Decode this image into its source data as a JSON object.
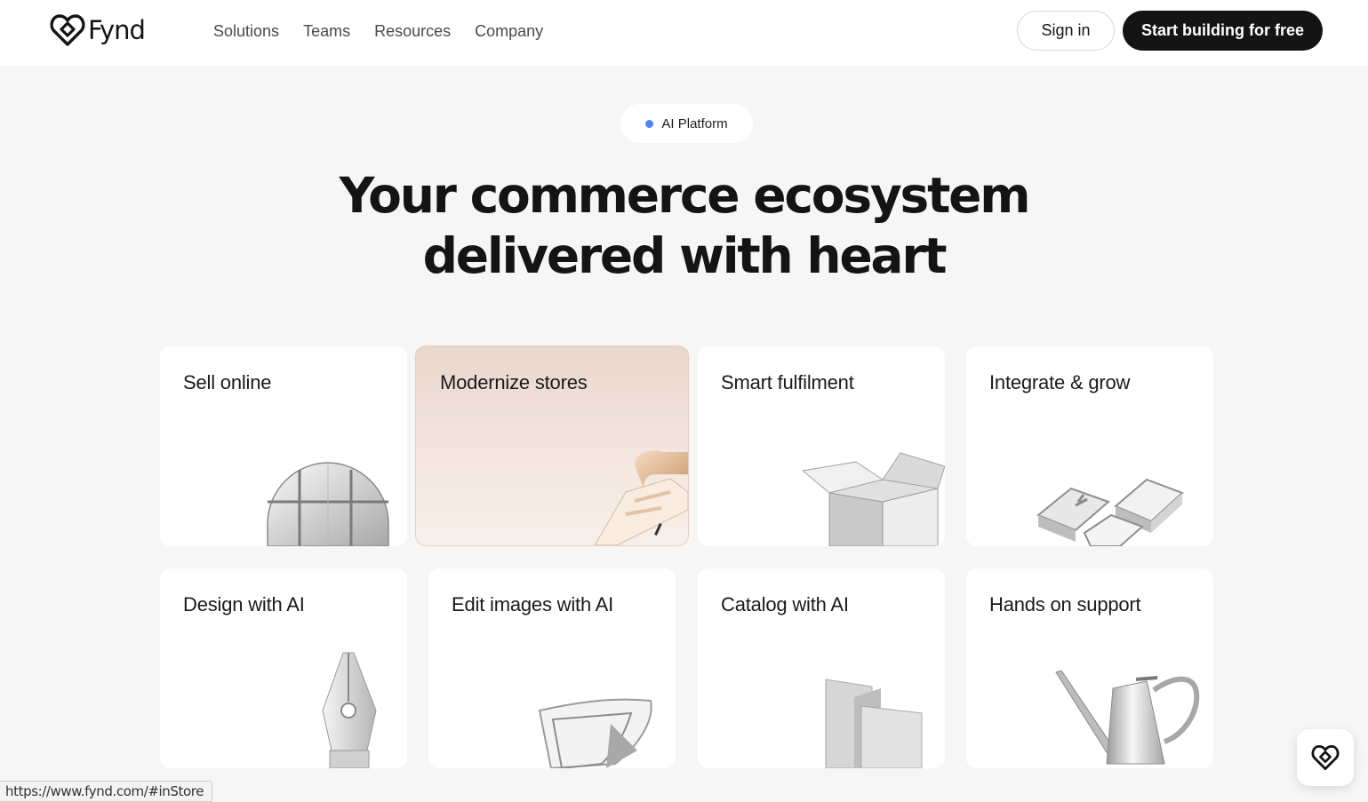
{
  "brand": {
    "name": "Fynd",
    "icon": "heart-logo-icon"
  },
  "nav": {
    "items": [
      {
        "label": "Solutions"
      },
      {
        "label": "Teams"
      },
      {
        "label": "Resources"
      },
      {
        "label": "Company"
      }
    ]
  },
  "header_actions": {
    "signin_label": "Sign in",
    "cta_label": "Start building for free"
  },
  "hero": {
    "badge": "AI Platform",
    "badge_dot_color": "#4f86f7",
    "title_line1": "Your commerce ecosystem",
    "title_line2": "delivered with heart"
  },
  "cards": [
    {
      "title": "Sell online",
      "icon": "globe-icon"
    },
    {
      "title": "Modernize stores",
      "icon": "pos-terminal-icon",
      "active": true
    },
    {
      "title": "Smart fulfilment",
      "icon": "open-box-icon"
    },
    {
      "title": "Integrate & grow",
      "icon": "keycaps-icon"
    },
    {
      "title": "Design with AI",
      "icon": "pen-nib-icon"
    },
    {
      "title": "Edit images with AI",
      "icon": "photo-frame-icon"
    },
    {
      "title": "Catalog with AI",
      "icon": "folded-cards-icon"
    },
    {
      "title": "Hands on support",
      "icon": "watering-can-icon"
    }
  ],
  "status_bar": {
    "url": "https://www.fynd.com/#inStore"
  },
  "chat": {
    "icon": "chat-heart-icon"
  },
  "colors": {
    "background": "#f6f6f6",
    "dark": "#141414",
    "active_card": "#ead6cd"
  }
}
